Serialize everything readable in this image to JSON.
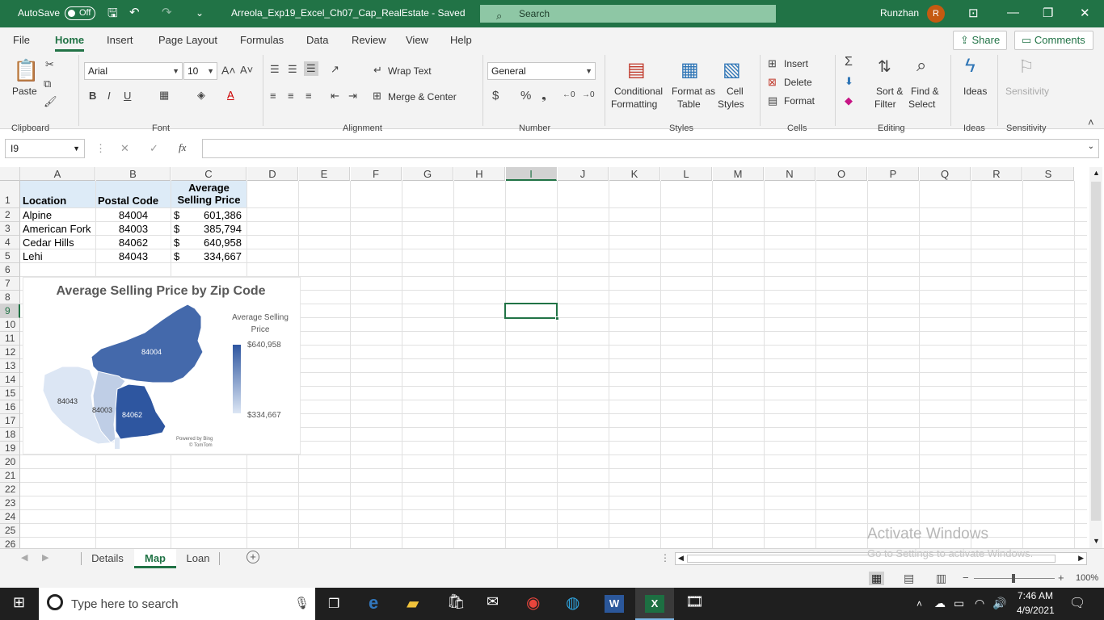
{
  "titlebar": {
    "autosave_label": "AutoSave",
    "autosave_state": "Off",
    "filename": "Arreola_Exp19_Excel_Ch07_Cap_RealEstate  -  Saved",
    "search_placeholder": "Search",
    "user_name": "Runzhan",
    "user_initial": "R"
  },
  "menu": [
    "File",
    "Home",
    "Insert",
    "Page Layout",
    "Formulas",
    "Data",
    "Review",
    "View",
    "Help"
  ],
  "share_label": "Share",
  "comments_label": "Comments",
  "ribbon": {
    "paste_label": "Paste",
    "font_name": "Arial",
    "font_size": "10",
    "wrap_text": "Wrap Text",
    "merge_center": "Merge & Center",
    "number_format": "General",
    "conditional_formatting": [
      "Conditional",
      "Formatting"
    ],
    "format_as_table": [
      "Format as",
      "Table"
    ],
    "cell_styles": [
      "Cell",
      "Styles"
    ],
    "insert": "Insert",
    "delete": "Delete",
    "format": "Format",
    "sort_filter": [
      "Sort &",
      "Filter"
    ],
    "find_select": [
      "Find &",
      "Select"
    ],
    "ideas": "Ideas",
    "sensitivity": "Sensitivity",
    "groups": [
      "Clipboard",
      "Font",
      "Alignment",
      "Number",
      "Styles",
      "Cells",
      "Editing",
      "Ideas",
      "Sensitivity"
    ]
  },
  "namebox": "I9",
  "columns": [
    "A",
    "B",
    "C",
    "D",
    "E",
    "F",
    "G",
    "H",
    "I",
    "J",
    "K",
    "L",
    "M",
    "N",
    "O",
    "P",
    "Q",
    "R",
    "S"
  ],
  "rows": [
    "1",
    "2",
    "3",
    "4",
    "5",
    "6",
    "7",
    "8",
    "9",
    "10",
    "11",
    "12",
    "13",
    "14",
    "15",
    "16",
    "17",
    "18",
    "19",
    "20",
    "21",
    "22",
    "23",
    "24",
    "25",
    "26"
  ],
  "table": {
    "headers": [
      "Location",
      "Postal Code",
      "Average",
      "Selling Price"
    ],
    "rows": [
      [
        "Alpine",
        "84004",
        "$",
        "601,386"
      ],
      [
        "American Fork",
        "84003",
        "$",
        "385,794"
      ],
      [
        "Cedar Hills",
        "84062",
        "$",
        "640,958"
      ],
      [
        "Lehi",
        "84043",
        "$",
        "334,667"
      ]
    ]
  },
  "chart": {
    "title": "Average Selling Price by Zip Code",
    "legend_title": [
      "Average Selling",
      "Price"
    ],
    "legend_max": "$640,958",
    "legend_min": "$334,667",
    "region_labels": [
      "84004",
      "84043",
      "84003",
      "84062"
    ],
    "attribution": [
      "Powered by Bing",
      "© TomTom"
    ]
  },
  "chart_data": {
    "type": "map",
    "title": "Average Selling Price by Zip Code",
    "categories": [
      "84004",
      "84003",
      "84062",
      "84043"
    ],
    "values": [
      601386,
      385794,
      640958,
      334667
    ],
    "color_scale": {
      "min": 334667,
      "max": 640958,
      "min_color": "#dce6f4",
      "max_color": "#2e56a0"
    }
  },
  "sheets": [
    "Details",
    "Map",
    "Loan"
  ],
  "active_sheet": "Map",
  "watermark": [
    "Activate Windows",
    "Go to Settings to activate Windows."
  ],
  "zoom": "100%",
  "taskbar": {
    "search_placeholder": "Type here to search",
    "time": "7:46 AM",
    "date": "4/9/2021"
  }
}
